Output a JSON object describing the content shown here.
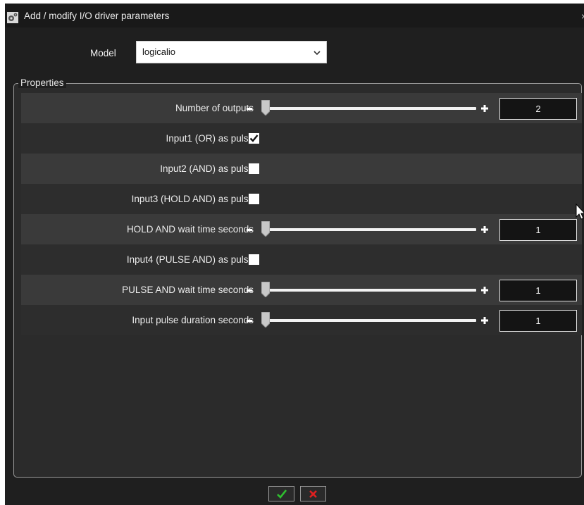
{
  "window": {
    "title": "Add / modify I/O driver parameters",
    "close_glyph": "×"
  },
  "model": {
    "label": "Model",
    "value": "logicalio"
  },
  "properties": {
    "legend": "Properties",
    "rows": [
      {
        "label": "Number of outputs",
        "kind": "slider",
        "value": "2",
        "level": 0
      },
      {
        "label": "Input1 (OR) as pulse",
        "kind": "checkbox",
        "checked": true
      },
      {
        "label": "Input2 (AND) as pulse",
        "kind": "checkbox",
        "checked": false
      },
      {
        "label": "Input3 (HOLD AND) as pulse",
        "kind": "checkbox",
        "checked": false
      },
      {
        "label": "HOLD AND wait time seconds",
        "kind": "slider",
        "value": "1",
        "level": 0
      },
      {
        "label": "Input4 (PULSE AND) as pulse",
        "kind": "checkbox",
        "checked": false
      },
      {
        "label": "PULSE AND wait time seconds",
        "kind": "slider",
        "value": "1",
        "level": 0
      },
      {
        "label": "Input pulse duration seconds",
        "kind": "slider",
        "value": "1",
        "level": 0
      }
    ]
  },
  "footer": {
    "ok_icon": "check-icon",
    "cancel_icon": "x-icon"
  },
  "colors": {
    "ok_green": "#2fbf2f",
    "cancel_red": "#e02020",
    "window_bg": "#1f1f1f"
  }
}
